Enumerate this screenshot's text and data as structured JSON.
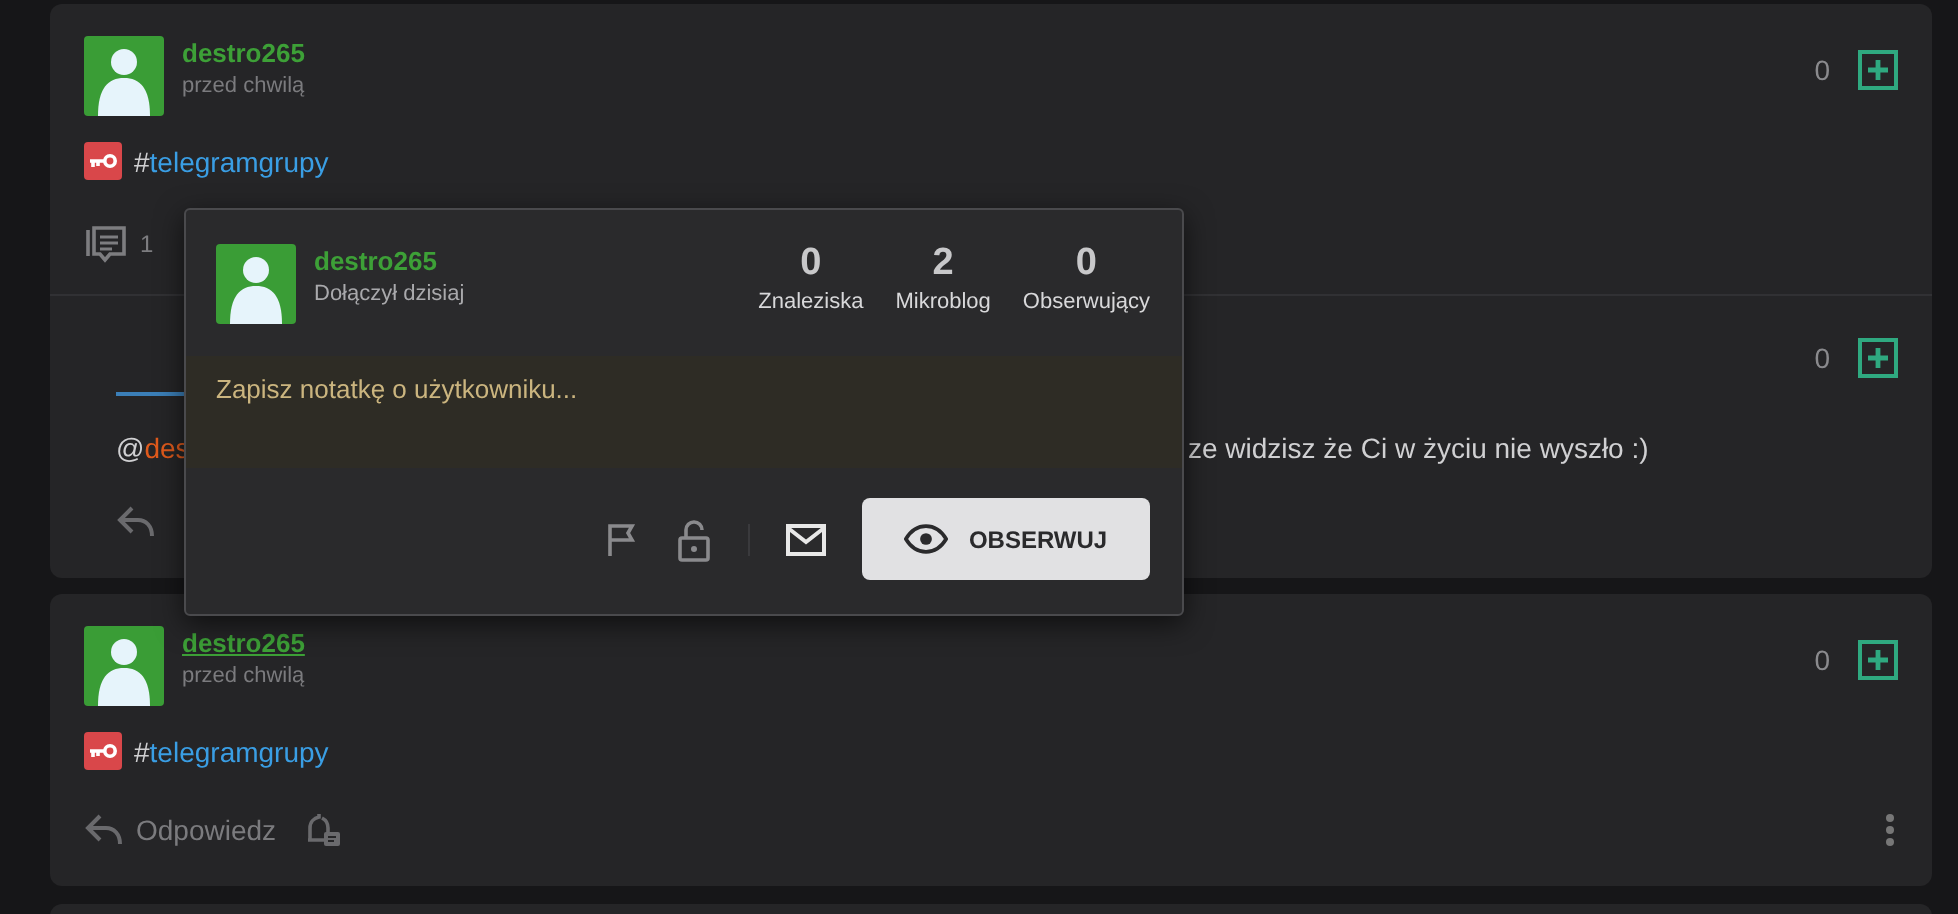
{
  "posts": [
    {
      "author": "destro265",
      "author_hovered": false,
      "time": "przed chwilą",
      "hash": "#",
      "tag": "telegramgrupy",
      "votes": "0",
      "comments": "1",
      "reply": {
        "votes": "0",
        "mention_at": "@",
        "mention_name": "des",
        "text_tail": "ze widzisz że Ci w życiu nie wyszło :)"
      }
    },
    {
      "author": "destro265",
      "author_hovered": true,
      "time": "przed chwilą",
      "hash": "#",
      "tag": "telegramgrupy",
      "votes": "0",
      "reply_label": "Odpowiedz"
    }
  ],
  "popup": {
    "name": "destro265",
    "joined": "Dołączył dzisiaj",
    "stats": [
      {
        "value": "0",
        "label": "Znaleziska"
      },
      {
        "value": "2",
        "label": "Mikroblog"
      },
      {
        "value": "0",
        "label": "Obserwujący"
      }
    ],
    "note_placeholder": "Zapisz notatkę o użytkowniku...",
    "follow_button": "OBSERWUJ"
  }
}
